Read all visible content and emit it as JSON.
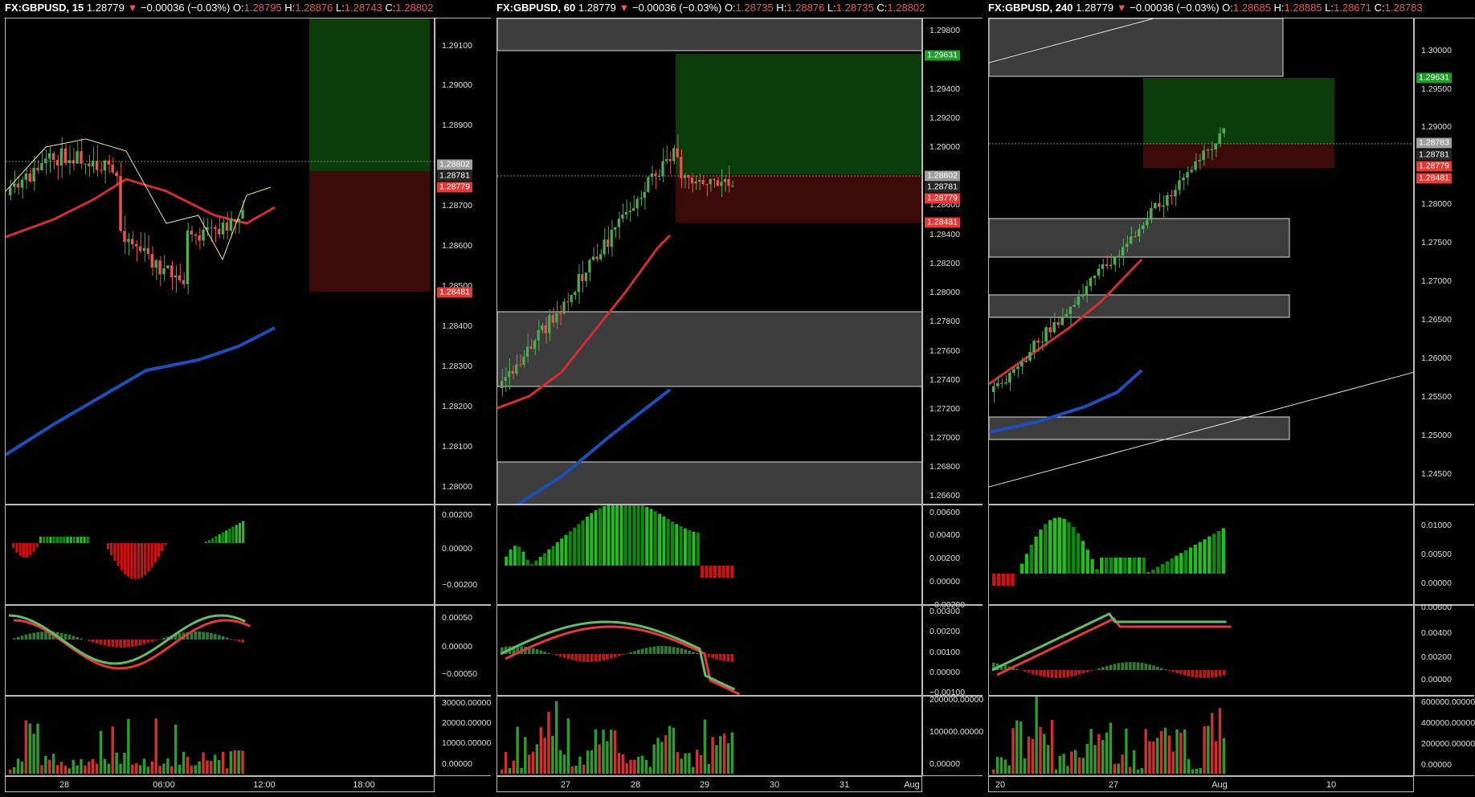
{
  "charts": [
    {
      "header": {
        "symbol": "FX:GBPUSD, 15",
        "last": "1.28779",
        "arrow": "▼",
        "change": "−0.00036 (−0.03%)",
        "o_label": "O:",
        "o": "1.28795",
        "h_label": "H:",
        "h": "1.28876",
        "l_label": "L:",
        "l": "1.28743",
        "c_label": "C:",
        "c": "1.28802"
      },
      "price_ticks": [
        "1.29100",
        "1.29000",
        "1.28900",
        "1.28700",
        "1.28600",
        "1.28500",
        "1.28400",
        "1.28300",
        "1.28200",
        "1.28100",
        "1.28000"
      ],
      "price_tags": [
        {
          "text": "1.28802",
          "color": "#9e9e9e"
        },
        {
          "text": "1.28781",
          "color": "#262626"
        },
        {
          "text": "1.28779",
          "color": "#e53935"
        },
        {
          "text": "1.28481",
          "color": "#e53935"
        }
      ],
      "ind1_ticks": [
        "0.00200",
        "0.00000",
        "−0.00200"
      ],
      "ind2_ticks": [
        "0.00050",
        "0.00000",
        "−0.00050"
      ],
      "vol_ticks": [
        "30000.00000",
        "20000.00000",
        "10000.00000",
        "0.00000"
      ],
      "time_labels": [
        "28",
        "06:00",
        "12:00",
        "18:00"
      ]
    },
    {
      "header": {
        "symbol": "FX:GBPUSD, 60",
        "last": "1.28779",
        "arrow": "▼",
        "change": "−0.00036 (−0.03%)",
        "o_label": "O:",
        "o": "1.28735",
        "h_label": "H:",
        "h": "1.28876",
        "l_label": "L:",
        "l": "1.28735",
        "c_label": "C:",
        "c": "1.28802"
      },
      "price_ticks": [
        "1.29800",
        "1.29400",
        "1.29200",
        "1.29000",
        "1.28600",
        "1.28400",
        "1.28200",
        "1.28000",
        "1.27800",
        "1.27600",
        "1.27400",
        "1.27200",
        "1.27000",
        "1.26800",
        "1.26600"
      ],
      "price_tags": [
        {
          "text": "1.29631",
          "color": "#1e9b2a"
        },
        {
          "text": "1.28802",
          "color": "#9e9e9e"
        },
        {
          "text": "1.28781",
          "color": "#262626"
        },
        {
          "text": "1.28779",
          "color": "#e53935"
        },
        {
          "text": "1.28481",
          "color": "#e53935"
        }
      ],
      "ind1_ticks": [
        "0.00600",
        "0.00400",
        "0.00200",
        "0.00000",
        "−0.00200"
      ],
      "ind2_ticks": [
        "0.00300",
        "0.00200",
        "0.00100",
        "0.00000",
        "−0.00100"
      ],
      "vol_ticks": [
        "200000.00000",
        "100000.00000",
        "0.00000"
      ],
      "time_labels": [
        "27",
        "28",
        "29",
        "30",
        "31",
        "Aug"
      ]
    },
    {
      "header": {
        "symbol": "FX:GBPUSD, 240",
        "last": "1.28779",
        "arrow": "▼",
        "change": "−0.00036 (−0.03%)",
        "o_label": "O:",
        "o": "1.28685",
        "h_label": "H:",
        "h": "1.28885",
        "l_label": "L:",
        "l": "1.28671",
        "c_label": "C:",
        "c": "1.28783"
      },
      "price_ticks": [
        "1.30000",
        "1.29500",
        "1.29000",
        "1.28000",
        "1.27500",
        "1.27000",
        "1.26500",
        "1.26000",
        "1.25500",
        "1.25000",
        "1.24500"
      ],
      "price_tags": [
        {
          "text": "1.29631",
          "color": "#1e9b2a"
        },
        {
          "text": "1.28783",
          "color": "#9e9e9e"
        },
        {
          "text": "1.28781",
          "color": "#262626"
        },
        {
          "text": "1.28779",
          "color": "#e53935"
        },
        {
          "text": "1.28481",
          "color": "#e53935"
        }
      ],
      "ind1_ticks": [
        "0.01000",
        "0.00500",
        "0.00000"
      ],
      "ind2_ticks": [
        "0.00600",
        "0.00400",
        "0.00200",
        "0.00000"
      ],
      "vol_ticks": [
        "600000.00000",
        "400000.00000",
        "200000.00000",
        "0.00000"
      ],
      "time_labels": [
        "20",
        "27",
        "Aug",
        "10"
      ]
    }
  ],
  "colors": {
    "bg": "#000000",
    "up": "#4caf50",
    "down": "#ef5350",
    "ma_red": "#d32f2f",
    "ma_blue": "#1e4fb8",
    "ma_yellow": "#f0e68c",
    "ma_green": "#2e7d32",
    "hist_up": "#1fbf1f",
    "hist_down": "#d01010",
    "zone": "#3d3d3d",
    "profit": "#0a3d0a",
    "loss": "#3d0a0a"
  }
}
